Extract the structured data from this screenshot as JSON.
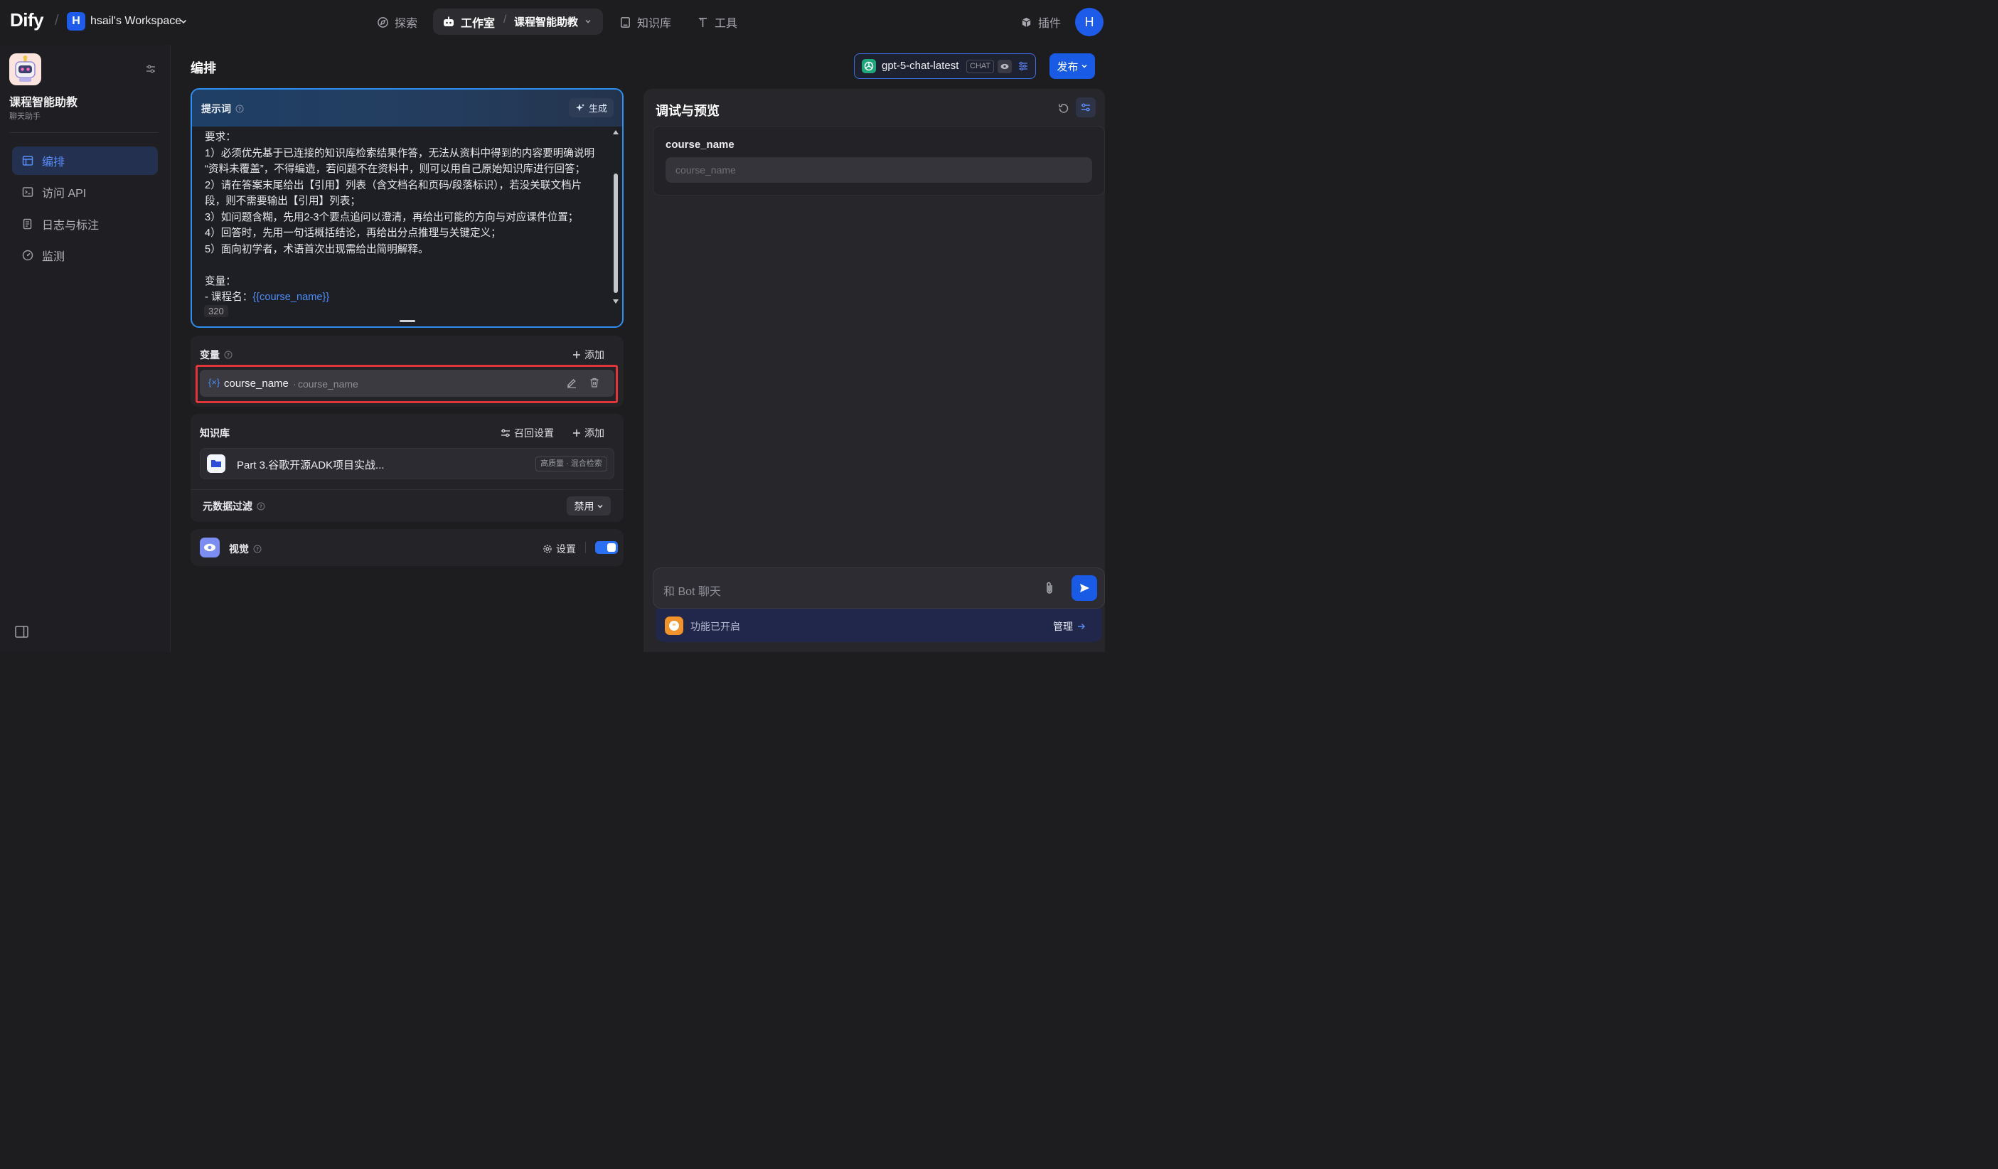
{
  "header": {
    "logo": "Dify",
    "workspace_initial": "H",
    "workspace_name": "hsail's Workspace",
    "nav": {
      "explore": "探索",
      "studio": "工作室",
      "current_app": "课程智能助教",
      "knowledge": "知识库",
      "tools": "工具",
      "plugins": "插件"
    },
    "user_initial": "H"
  },
  "sidebar": {
    "app_name": "课程智能助教",
    "app_type": "聊天助手",
    "items": [
      {
        "label": "编排",
        "active": true
      },
      {
        "label": "访问 API",
        "active": false
      },
      {
        "label": "日志与标注",
        "active": false
      },
      {
        "label": "监测",
        "active": false
      }
    ]
  },
  "orchestrate": {
    "title": "编排",
    "prompt": {
      "label": "提示词",
      "generate_label": "生成",
      "text": "要求：\n1）必须优先基于已连接的知识库检索结果作答，无法从资料中得到的内容要明确说明\n“资料未覆盖”，不得编造，若问题不在资料中，则可以用自己原始知识库进行回答；\n2）请在答案末尾给出【引用】列表（含文档名和页码/段落标识），若没关联文档片\n段，则不需要输出【引用】列表；\n3）如问题含糊，先用2-3个要点追问以澄清，再给出可能的方向与对应课件位置；\n4）回答时，先用一句话概括结论，再给出分点推理与关键定义；\n5）面向初学者，术语首次出现需给出简明解释。\n\n变量：\n- 课程名：",
      "variable_ref": "{{course_name}}",
      "char_count": "320"
    },
    "variables": {
      "label": "变量",
      "add_label": "添加",
      "items": [
        {
          "key": "course_name",
          "name": "course_name"
        }
      ]
    },
    "knowledge": {
      "label": "知识库",
      "retrieval_label": "召回设置",
      "add_label": "添加",
      "items": [
        {
          "name": "Part 3.谷歌开源ADK项目实战...",
          "tag": "高质量 · 混合检索"
        }
      ]
    },
    "metadata_filter": {
      "label": "元数据过滤",
      "value": "禁用"
    },
    "vision": {
      "label": "视觉",
      "settings_label": "设置",
      "enabled": true
    }
  },
  "model": {
    "name": "gpt-5-chat-latest",
    "mode": "CHAT"
  },
  "publish_label": "发布",
  "debug": {
    "title": "调试与预览",
    "input_label": "course_name",
    "input_placeholder": "course_name",
    "chat_placeholder": "和 Bot 聊天",
    "features_label": "功能已开启",
    "manage_label": "管理"
  },
  "colors": {
    "accent": "#1a5be6",
    "link": "#4d8df7",
    "highlight_border": "#e0363a"
  }
}
